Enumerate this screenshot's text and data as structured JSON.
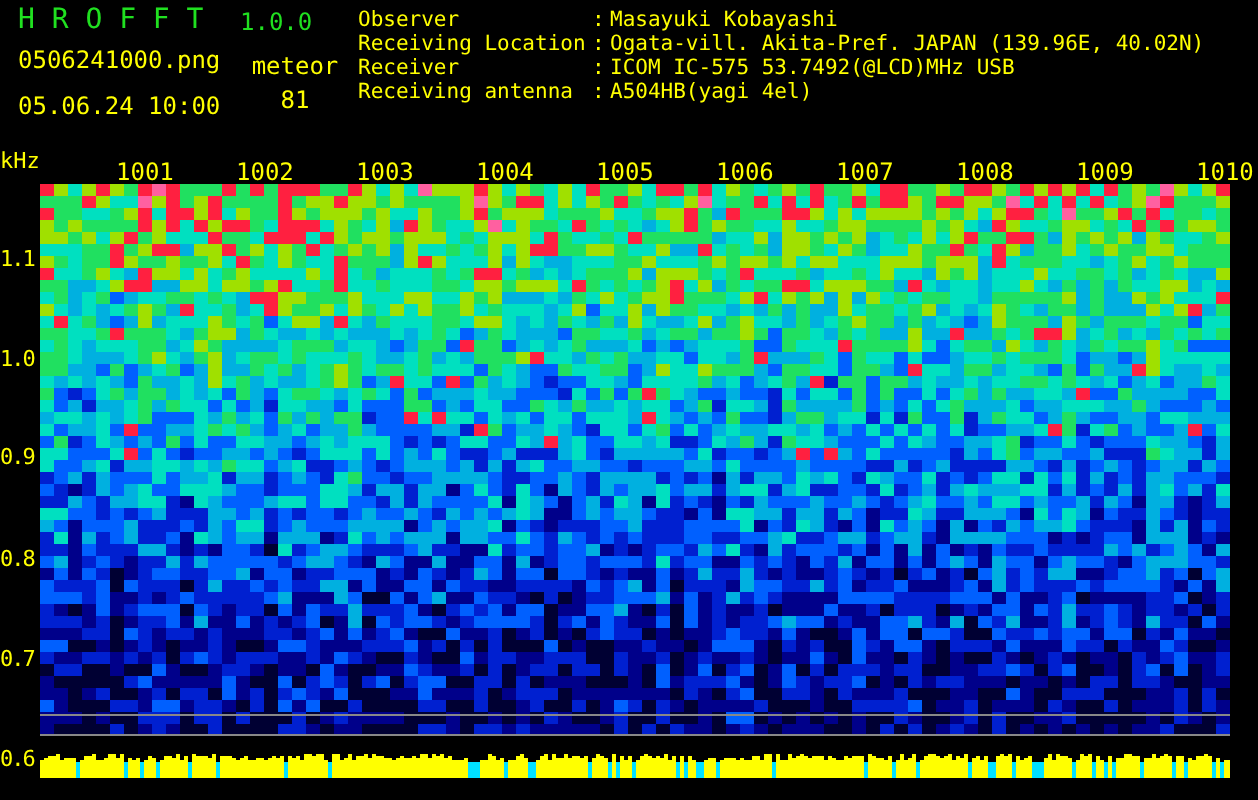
{
  "app": {
    "name": "H R O F F T",
    "version": "1.0.0"
  },
  "file": {
    "filename": "0506241000.png",
    "datetime": "05.06.24 10:00"
  },
  "meteor": {
    "label": "meteor",
    "count": "81"
  },
  "station": [
    {
      "label": "Observer",
      "colon": ":",
      "value": "Masayuki Kobayashi"
    },
    {
      "label": "Receiving Location",
      "colon": ":",
      "value": "Ogata-vill. Akita-Pref. JAPAN (139.96E, 40.02N)"
    },
    {
      "label": "Receiver",
      "colon": ":",
      "value": "ICOM IC-575 53.7492(@LCD)MHz USB"
    },
    {
      "label": "Receiving antenna",
      "colon": ":",
      "value": "A504HB(yagi 4el)"
    }
  ],
  "axis": {
    "unit": "kHz",
    "x_labels": [
      "1001",
      "1002",
      "1003",
      "1004",
      "1005",
      "1006",
      "1007",
      "1008",
      "1009",
      "1010"
    ],
    "y_labels": [
      "1.1",
      "1.0",
      "0.9",
      "0.8",
      "0.7",
      "0.6"
    ]
  }
}
